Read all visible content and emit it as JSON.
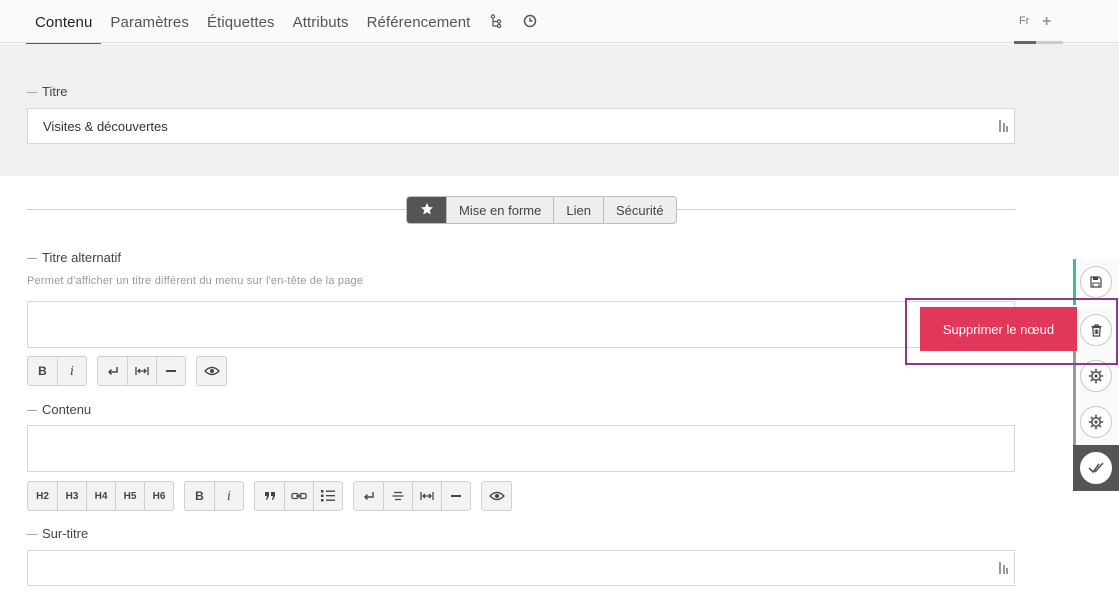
{
  "tabs": {
    "items": [
      "Contenu",
      "Paramètres",
      "Étiquettes",
      "Attributs",
      "Référencement"
    ],
    "tree_icon": "tree-icon",
    "history_icon": "clock-icon"
  },
  "lang": {
    "current": "Fr",
    "add": "+"
  },
  "fields": {
    "title_label": "Titre",
    "title_value": "Visites & découvertes",
    "alt_title_label": "Titre alternatif",
    "alt_title_help": "Permet d'afficher un titre différent du menu sur l'en-tête de la page",
    "content_label": "Contenu",
    "surtitle_label": "Sur-titre"
  },
  "filter_tabs": {
    "star_icon": "star-icon",
    "items": [
      "Mise en forme",
      "Lien",
      "Sécurité"
    ]
  },
  "toolbar1": {
    "bold": "B",
    "italic": "i"
  },
  "toolbar2": {
    "headings": [
      "H2",
      "H3",
      "H4",
      "H5",
      "H6"
    ],
    "bold": "B",
    "italic": "i"
  },
  "actions": {
    "delete_label": "Supprimer le nœud",
    "icons": [
      "save-icon",
      "trash-icon",
      "gear-icon",
      "gear-icon",
      "check-icon"
    ]
  },
  "colors": {
    "accent_green": "#3fbf8f",
    "danger": "#e0375a",
    "highlight": "#8b3a8f"
  }
}
